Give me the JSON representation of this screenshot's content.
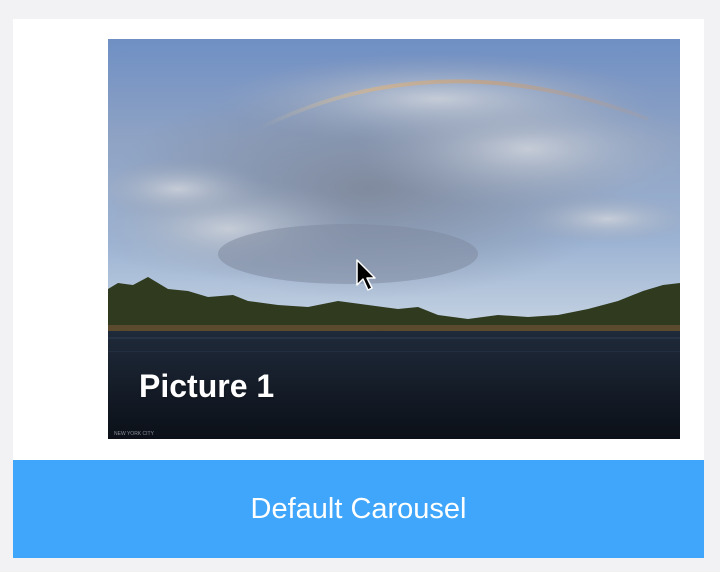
{
  "carousel": {
    "title": "Default Carousel",
    "current_slide": {
      "caption": "Picture 1",
      "credit": "NEW YORK CITY",
      "image_subject": "rainbow over lake with cloudy sky"
    }
  },
  "colors": {
    "background": "#f2f2f4",
    "card": "#ffffff",
    "footer_button": "#3fa6fb",
    "caption_text": "#ffffff"
  },
  "icons": {
    "cursor": "mouse-pointer-icon"
  }
}
